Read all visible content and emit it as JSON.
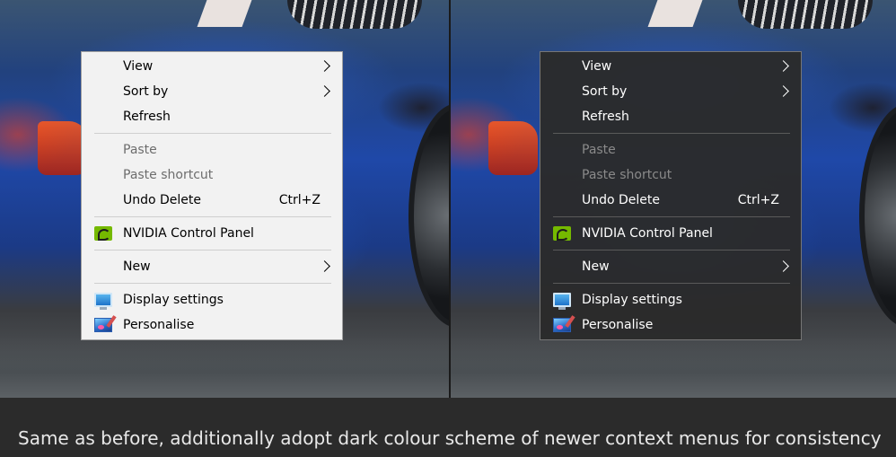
{
  "menu": {
    "items": [
      {
        "label": "View",
        "submenu": true
      },
      {
        "label": "Sort by",
        "submenu": true
      },
      {
        "label": "Refresh"
      },
      {
        "label": "Paste",
        "disabled": true
      },
      {
        "label": "Paste shortcut",
        "disabled": true
      },
      {
        "label": "Undo Delete",
        "shortcut": "Ctrl+Z"
      },
      {
        "label": "NVIDIA Control Panel",
        "icon": "nvidia-icon"
      },
      {
        "label": "New",
        "submenu": true
      },
      {
        "label": "Display settings",
        "icon": "display-icon"
      },
      {
        "label": "Personalise",
        "icon": "personalise-icon"
      }
    ]
  },
  "caption": {
    "text": "Same as before, additionally adopt dark colour scheme of newer context menus for consistency"
  },
  "colors": {
    "light_menu_bg": "#f2f2f2",
    "dark_menu_bg": "#2b2b2b",
    "page_bg": "#2b2b2b",
    "nvidia_green": "#75b900"
  }
}
